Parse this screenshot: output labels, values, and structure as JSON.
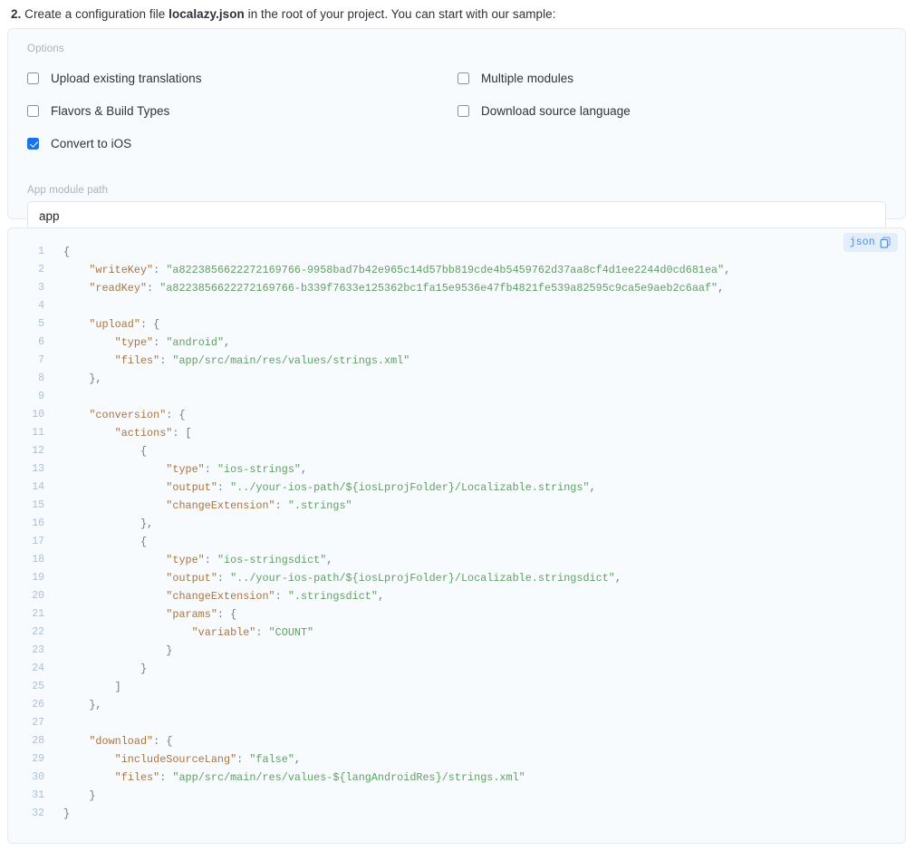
{
  "heading": {
    "number": "2.",
    "before": " Create a configuration file ",
    "file": "localazy.json",
    "after": " in the root of your project. You can start with our sample:"
  },
  "options_panel": {
    "legend": "Options",
    "checkboxes": [
      {
        "label": "Upload existing translations",
        "checked": false
      },
      {
        "label": "Multiple modules",
        "checked": false
      },
      {
        "label": "Flavors & Build Types",
        "checked": false
      },
      {
        "label": "Download source language",
        "checked": false
      },
      {
        "label": "Convert to iOS",
        "checked": true
      }
    ],
    "module_path": {
      "label": "App module path",
      "value": "app",
      "placeholder": "App module path"
    }
  },
  "code_block": {
    "language": "json",
    "copy_icon": "copy-icon",
    "lines": [
      {
        "n": "1",
        "text": "{"
      },
      {
        "n": "2",
        "text": "    \"writeKey\": \"a8223856622272169766-9958bad7b42e965c14d57bb819cde4b5459762d37aa8cf4d1ee2244d0cd681ea\","
      },
      {
        "n": "3",
        "text": "    \"readKey\": \"a8223856622272169766-b339f7633e125362bc1fa15e9536e47fb4821fe539a82595c9ca5e9aeb2c6aaf\","
      },
      {
        "n": "4",
        "text": ""
      },
      {
        "n": "5",
        "text": "    \"upload\": {"
      },
      {
        "n": "6",
        "text": "        \"type\": \"android\","
      },
      {
        "n": "7",
        "text": "        \"files\": \"app/src/main/res/values/strings.xml\""
      },
      {
        "n": "8",
        "text": "    },"
      },
      {
        "n": "9",
        "text": ""
      },
      {
        "n": "10",
        "text": "    \"conversion\": {"
      },
      {
        "n": "11",
        "text": "        \"actions\": ["
      },
      {
        "n": "12",
        "text": "            {"
      },
      {
        "n": "13",
        "text": "                \"type\": \"ios-strings\","
      },
      {
        "n": "14",
        "text": "                \"output\": \"../your-ios-path/${iosLprojFolder}/Localizable.strings\","
      },
      {
        "n": "15",
        "text": "                \"changeExtension\": \".strings\""
      },
      {
        "n": "16",
        "text": "            },"
      },
      {
        "n": "17",
        "text": "            {"
      },
      {
        "n": "18",
        "text": "                \"type\": \"ios-stringsdict\","
      },
      {
        "n": "19",
        "text": "                \"output\": \"../your-ios-path/${iosLprojFolder}/Localizable.stringsdict\","
      },
      {
        "n": "20",
        "text": "                \"changeExtension\": \".stringsdict\","
      },
      {
        "n": "21",
        "text": "                \"params\": {"
      },
      {
        "n": "22",
        "text": "                    \"variable\": \"COUNT\""
      },
      {
        "n": "23",
        "text": "                }"
      },
      {
        "n": "24",
        "text": "            }"
      },
      {
        "n": "25",
        "text": "        ]"
      },
      {
        "n": "26",
        "text": "    },"
      },
      {
        "n": "27",
        "text": ""
      },
      {
        "n": "28",
        "text": "    \"download\": {"
      },
      {
        "n": "29",
        "text": "        \"includeSourceLang\": \"false\","
      },
      {
        "n": "30",
        "text": "        \"files\": \"app/src/main/res/values-${langAndroidRes}/strings.xml\""
      },
      {
        "n": "31",
        "text": "    }"
      },
      {
        "n": "32",
        "text": "}"
      }
    ]
  },
  "colors": {
    "accent": "#1a73e8",
    "panel_bg": "#f8fbfd",
    "panel_border": "#e3ebf2",
    "badge_bg": "#e3eefb",
    "badge_fg": "#4c8ae0",
    "line_number": "#a9c0dd",
    "json_key": "#a9743f",
    "json_string": "#5f9f63",
    "json_punctuation": "#6f7a85"
  }
}
